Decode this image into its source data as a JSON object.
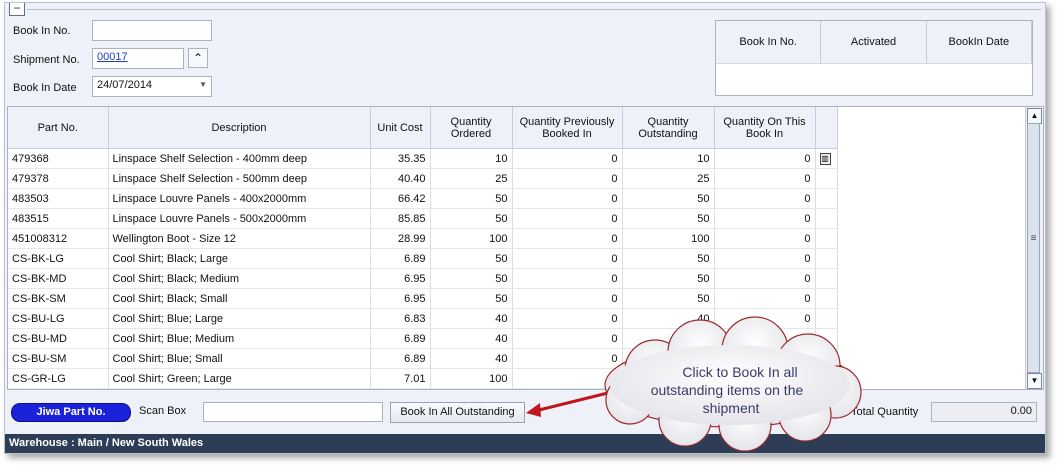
{
  "header": {
    "book_in_no_label": "Book In No.",
    "book_in_no_value": "",
    "shipment_no_label": "Shipment No.",
    "shipment_no_value": "00017",
    "book_in_date_label": "Book In Date",
    "book_in_date_value": "24/07/2014",
    "collapse_glyph": "−",
    "spin_glyph": "⌃"
  },
  "bookin_grid": {
    "columns": [
      "Book In No.",
      "Activated",
      "BookIn Date"
    ]
  },
  "main_grid": {
    "columns": [
      "Part No.",
      "Description",
      "Unit Cost",
      "Quantity Ordered",
      "Quantity Previously Booked In",
      "Quantity Outstanding",
      "Quantity On This Book In"
    ],
    "rows": [
      {
        "part": "479368",
        "desc": "Linspace Shelf Selection - 400mm deep",
        "cost": "35.35",
        "ordered": "10",
        "prev": "0",
        "outstanding": "10",
        "this": "0"
      },
      {
        "part": "479378",
        "desc": "Linspace Shelf Selection - 500mm deep",
        "cost": "40.40",
        "ordered": "25",
        "prev": "0",
        "outstanding": "25",
        "this": "0"
      },
      {
        "part": "483503",
        "desc": "Linspace Louvre Panels - 400x2000mm",
        "cost": "66.42",
        "ordered": "50",
        "prev": "0",
        "outstanding": "50",
        "this": "0"
      },
      {
        "part": "483515",
        "desc": "Linspace Louvre Panels - 500x2000mm",
        "cost": "85.85",
        "ordered": "50",
        "prev": "0",
        "outstanding": "50",
        "this": "0"
      },
      {
        "part": "451008312",
        "desc": "Wellington Boot - Size 12",
        "cost": "28.99",
        "ordered": "100",
        "prev": "0",
        "outstanding": "100",
        "this": "0"
      },
      {
        "part": "CS-BK-LG",
        "desc": "Cool Shirt; Black; Large",
        "cost": "6.89",
        "ordered": "50",
        "prev": "0",
        "outstanding": "50",
        "this": "0"
      },
      {
        "part": "CS-BK-MD",
        "desc": "Cool Shirt; Black; Medium",
        "cost": "6.95",
        "ordered": "50",
        "prev": "0",
        "outstanding": "50",
        "this": "0"
      },
      {
        "part": "CS-BK-SM",
        "desc": "Cool Shirt; Black; Small",
        "cost": "6.95",
        "ordered": "50",
        "prev": "0",
        "outstanding": "50",
        "this": "0"
      },
      {
        "part": "CS-BU-LG",
        "desc": "Cool Shirt; Blue; Large",
        "cost": "6.83",
        "ordered": "40",
        "prev": "0",
        "outstanding": "40",
        "this": "0"
      },
      {
        "part": "CS-BU-MD",
        "desc": "Cool Shirt; Blue; Medium",
        "cost": "6.89",
        "ordered": "40",
        "prev": "0",
        "outstanding": "40",
        "this": "0"
      },
      {
        "part": "CS-BU-SM",
        "desc": "Cool Shirt; Blue; Small",
        "cost": "6.89",
        "ordered": "40",
        "prev": "0",
        "outstanding": "",
        "this": ""
      },
      {
        "part": "CS-GR-LG",
        "desc": "Cool Shirt; Green; Large",
        "cost": "7.01",
        "ordered": "100",
        "prev": "",
        "outstanding": "",
        "this": ""
      }
    ]
  },
  "bottom": {
    "jiwa_part_label": "Jiwa Part No.",
    "scan_box_label": "Scan Box",
    "scan_box_value": "",
    "book_in_all_label": "Book In All Outstanding",
    "total_quantity_label": "Total Quantity",
    "total_quantity_value": "0.00"
  },
  "status_bar": {
    "warehouse": "Warehouse : Main / New South Wales"
  },
  "callout": {
    "lines": [
      "Click to Book In all",
      "outstanding items on the",
      "shipment"
    ]
  },
  "colors": {
    "accent": "#1a23d9",
    "status_bg": "#2c3d55",
    "callout_arrow": "#c0161c"
  }
}
